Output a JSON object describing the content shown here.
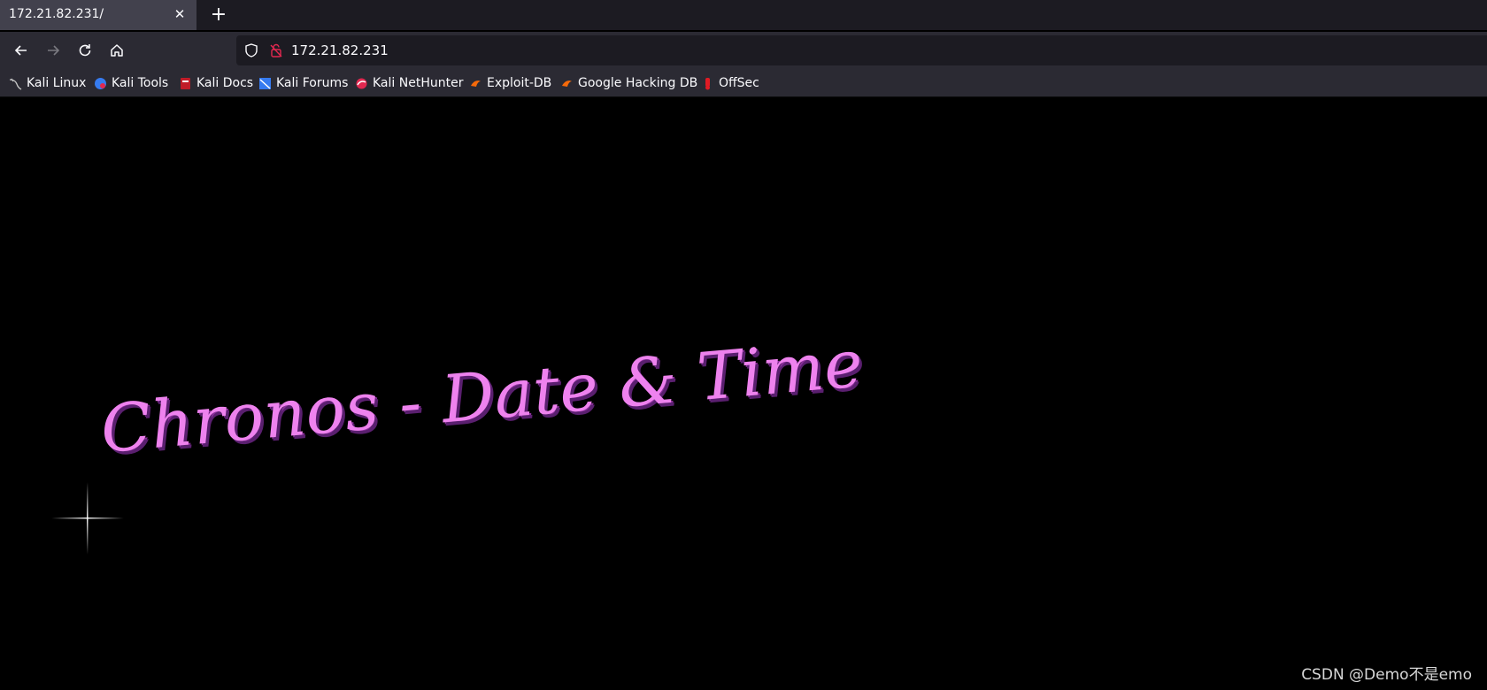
{
  "tab": {
    "title": "172.21.82.231/",
    "close_icon": "close-icon"
  },
  "new_tab_icon": "plus-icon",
  "nav": {
    "back_icon": "arrow-left-icon",
    "forward_icon": "arrow-right-icon",
    "reload_icon": "reload-icon",
    "home_icon": "home-icon"
  },
  "url": {
    "value": "172.21.82.231",
    "shield_icon": "shield-icon",
    "lock_icon": "insecure-lock-icon"
  },
  "bookmarks": [
    {
      "label": "Kali Linux",
      "icon": "kali-dragon-icon"
    },
    {
      "label": "Kali Tools",
      "icon": "kali-tools-icon"
    },
    {
      "label": "Kali Docs",
      "icon": "kali-docs-icon"
    },
    {
      "label": "Kali Forums",
      "icon": "kali-forums-icon"
    },
    {
      "label": "Kali NetHunter",
      "icon": "nethunter-icon"
    },
    {
      "label": "Exploit-DB",
      "icon": "exploit-db-icon"
    },
    {
      "label": "Google Hacking DB",
      "icon": "ghdb-icon"
    },
    {
      "label": "OffSec",
      "icon": "offsec-icon"
    }
  ],
  "page": {
    "headline": "Chronos - Date & Time",
    "headline_color": "#ee82ee",
    "sparkle_icon": "sparkle-icon"
  },
  "watermark": "CSDN @Demo不是emo"
}
